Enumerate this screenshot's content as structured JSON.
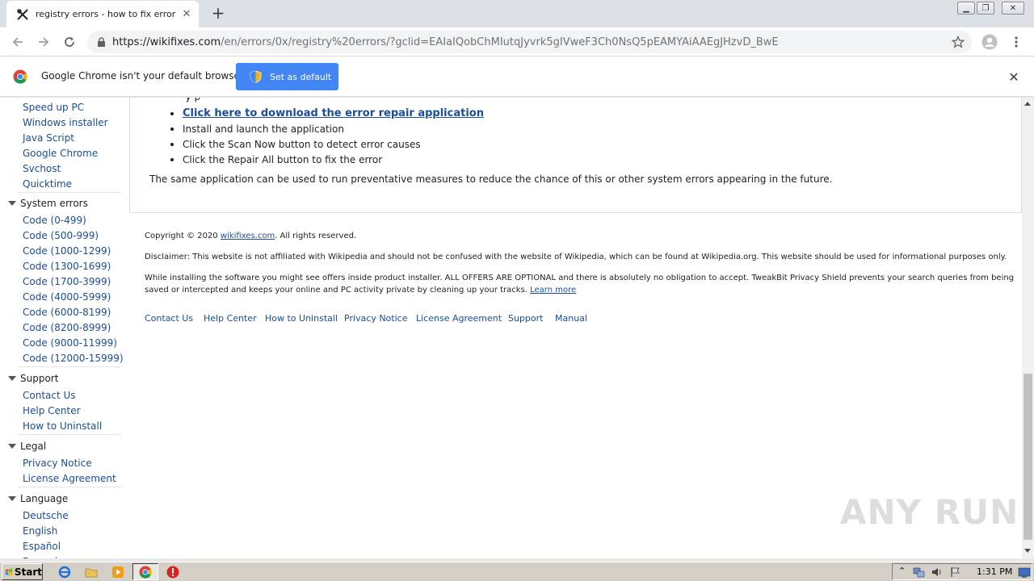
{
  "browser": {
    "tab_title": "registry errors - how to fix error",
    "url_host": "https://wikifixes.com",
    "url_path": "/en/errors/0x/registry%20errors/?gclid=EAIaIQobChMIutqJyvrk5gIVweF3Ch0NsQ5pEAMYAiAAEgJHzvD_BwE",
    "infobar_text": "Google Chrome isn't your default browser",
    "set_default_label": "Set as default"
  },
  "sidebar": {
    "top_links": [
      "Speed up PC",
      "Windows installer",
      "Java Script",
      "Google Chrome",
      "Svchost",
      "Quicktime"
    ],
    "sections": [
      {
        "title": "System errors",
        "links": [
          "Code (0-499)",
          "Code (500-999)",
          "Code (1000-1299)",
          "Code (1300-1699)",
          "Code (1700-3999)",
          "Code (4000-5999)",
          "Code (6000-8199)",
          "Code (8200-8999)",
          "Code (9000-11999)",
          "Code (12000-15999)"
        ]
      },
      {
        "title": "Support",
        "links": [
          "Contact Us",
          "Help Center",
          "How to Uninstall"
        ]
      },
      {
        "title": "Legal",
        "links": [
          "Privacy Notice",
          "License Agreement"
        ]
      },
      {
        "title": "Language",
        "links": [
          "Deutsche",
          "English",
          "Español",
          "Français"
        ]
      }
    ]
  },
  "content": {
    "download_link": "Click here to download the error repair application",
    "steps": [
      "Install and launch the application",
      "Click the Scan Now button to detect error causes",
      "Click the Repair All button to fix the error"
    ],
    "paragraph": "The same application can be used to run preventative measures to reduce the chance of this or other system errors appearing in the future."
  },
  "footer": {
    "copyright_prefix": "Copyright © 2020 ",
    "copyright_link": "wikifixes.com",
    "copyright_suffix": ". All rights reserved.",
    "disclaimer": "Disclaimer: This website is not affiliated with Wikipedia and should not be confused with the website of Wikipedia, which can be found at Wikipedia.org. This website should be used for informational purposes only.",
    "offers_line1": "While installing the software you might see offers inside product installer. ALL OFFERS ARE OPTIONAL and there is absolutely no obligation to accept. TweakBit Privacy Shield prevents your search queries from being",
    "offers_line2": "saved or intercepted and keeps your online and PC activity private by cleaning up your tracks. ",
    "learn_more": "Learn more",
    "links": [
      "Contact Us",
      "Help Center",
      "How to Uninstall",
      "Privacy Notice",
      "License Agreement",
      "Support",
      "Manual"
    ]
  },
  "taskbar": {
    "start_label": "Start",
    "clock": "1:31 PM"
  },
  "watermark": "ANY RUN"
}
